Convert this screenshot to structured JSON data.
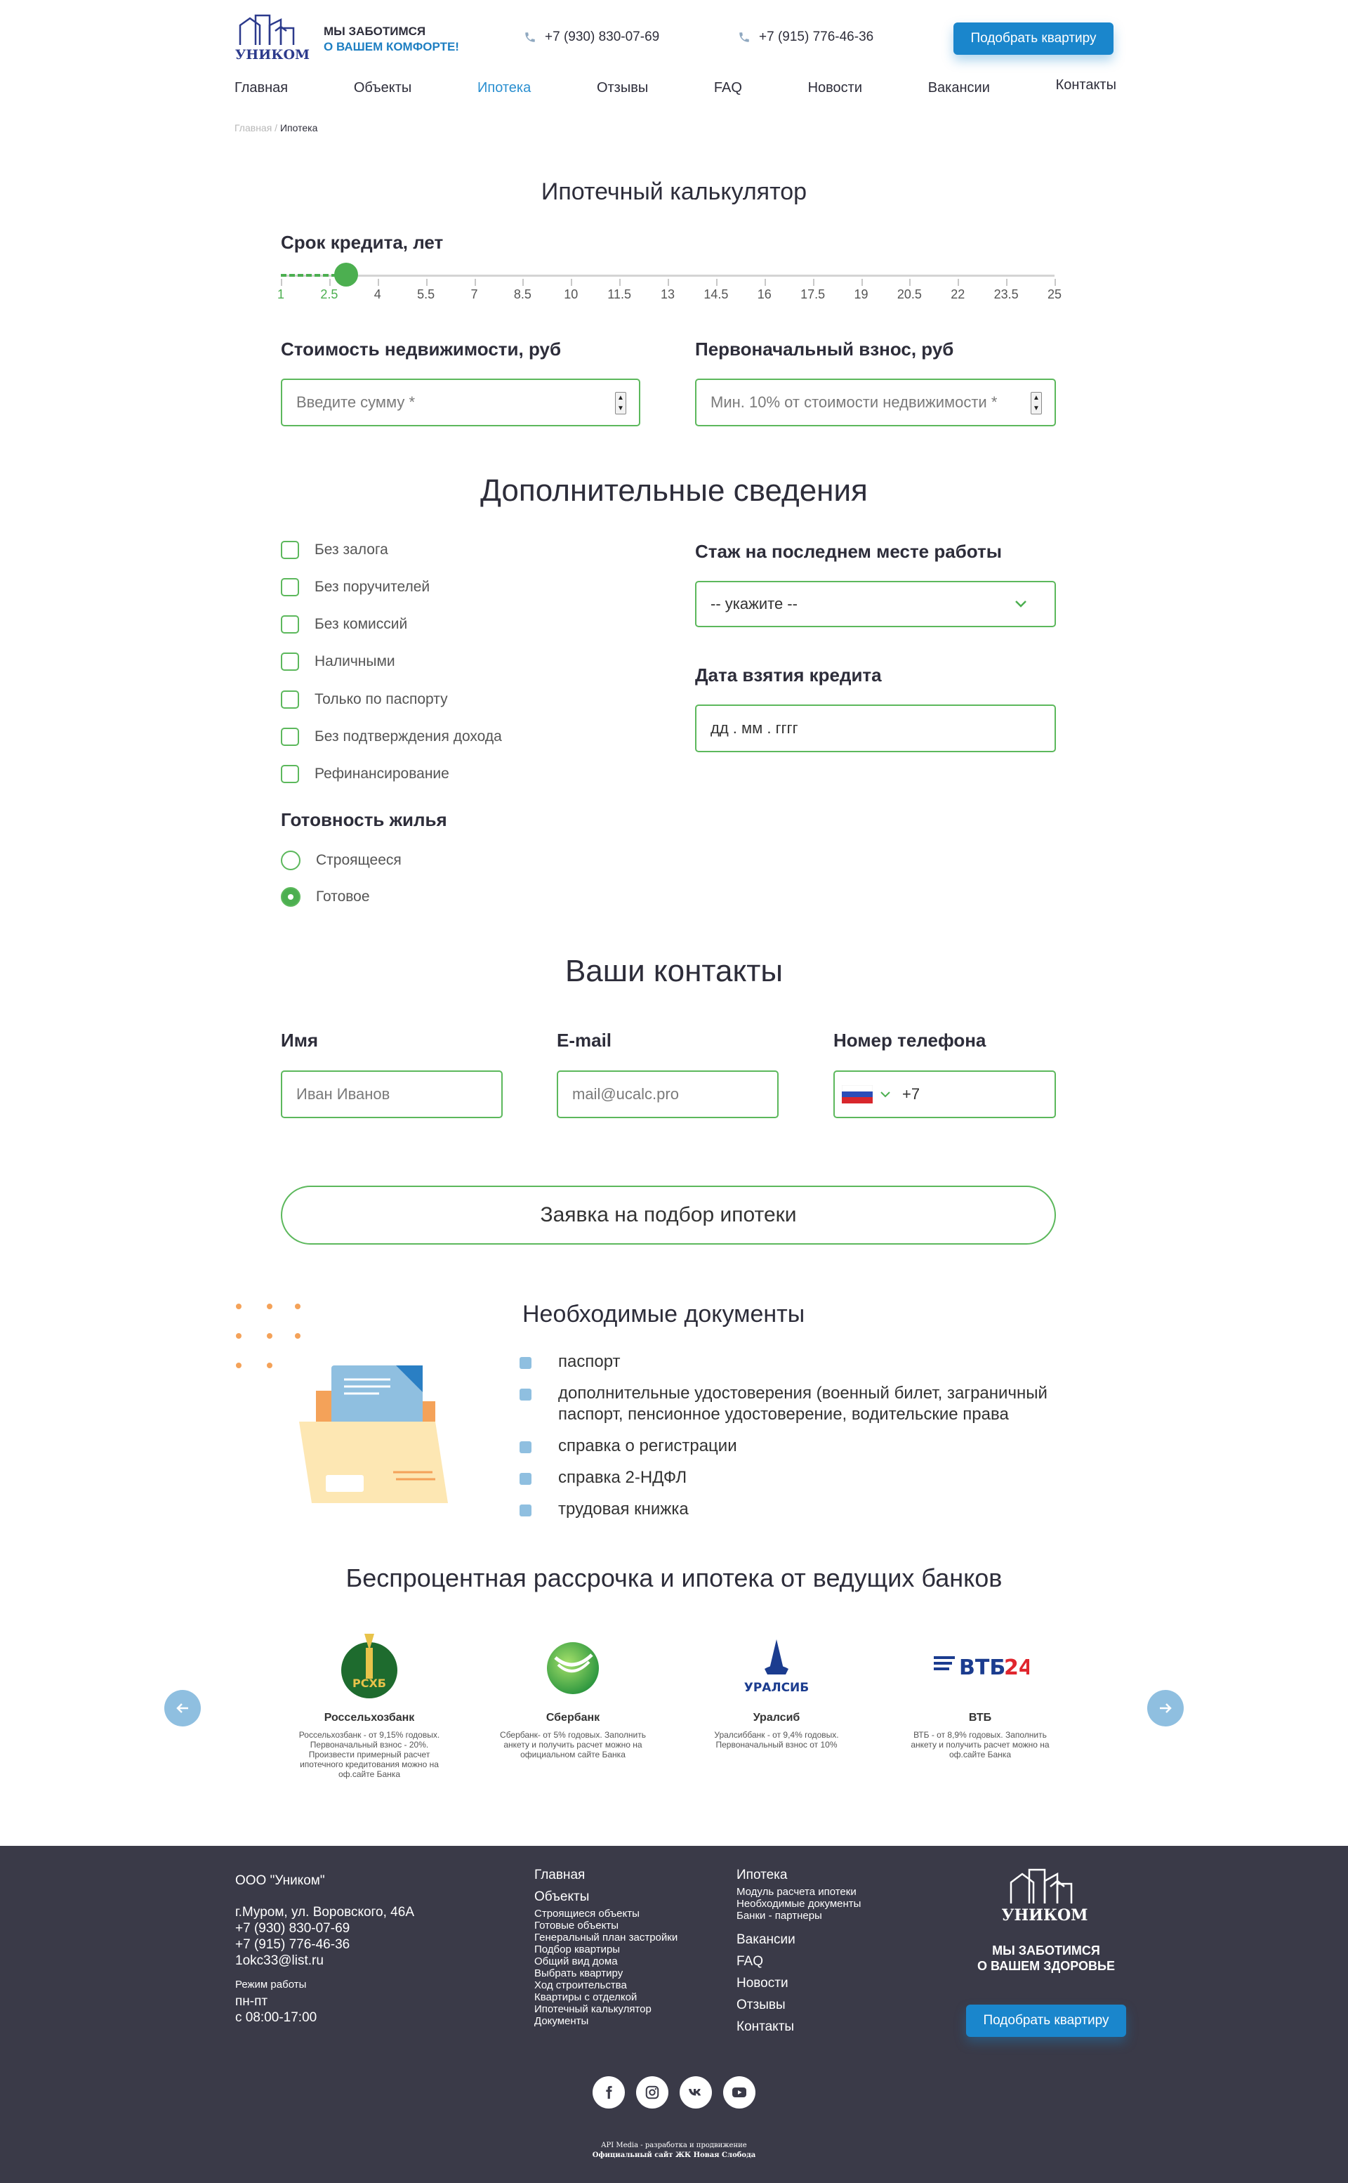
{
  "header": {
    "logo_text": "УНИКОМ",
    "tagline1": "МЫ ЗАБОТИМСЯ",
    "tagline2": "О ВАШЕМ КОМФОРТЕ!",
    "phone1": "+7 (930) 830-07-69",
    "phone2": "+7 (915) 776-46-36",
    "cta": "Подобрать квартиру"
  },
  "nav": [
    "Главная",
    "Объекты",
    "Ипотека",
    "Отзывы",
    "FAQ",
    "Новости",
    "Вакансии",
    "Контакты"
  ],
  "nav_active": "Ипотека",
  "breadcrumb": {
    "home": "Главная",
    "sep": " / ",
    "current": "Ипотека"
  },
  "calculator": {
    "title": "Ипотечный калькулятор",
    "term_label": "Срок кредита, лет",
    "term_value": 2.5,
    "term_ticks": [
      "1",
      "2.5",
      "4",
      "5.5",
      "7",
      "8.5",
      "10",
      "11.5",
      "13",
      "14.5",
      "16",
      "17.5",
      "19",
      "20.5",
      "22",
      "23.5",
      "25"
    ],
    "price_label": "Стоимость недвижимости, руб",
    "price_placeholder": "Введите сумму *",
    "down_label": "Первоначальный взнос, руб",
    "down_placeholder": "Мин. 10% от стоимости недвижимости *"
  },
  "extra": {
    "title": "Дополнительные сведения",
    "checkboxes": [
      "Без залога",
      "Без поручителей",
      "Без комиссий",
      "Наличными",
      "Только по паспорту",
      "Без подтверждения дохода",
      "Рефинансирование"
    ],
    "readiness_label": "Готовность жилья",
    "radios": [
      "Строящееся",
      "Готовое"
    ],
    "radio_selected": "Готовое",
    "experience_label": "Стаж на последнем месте работы",
    "experience_value": "-- укажите --",
    "date_label": "Дата взятия кредита",
    "date_placeholder": "дд . мм . гггг"
  },
  "contacts": {
    "title": "Ваши контакты",
    "name_label": "Имя",
    "name_placeholder": "Иван Иванов",
    "email_label": "E-mail",
    "email_placeholder": "mail@ucalc.pro",
    "phone_label": "Номер телефона",
    "phone_prefix": "+7",
    "submit": "Заявка на подбор ипотеки"
  },
  "documents": {
    "title": "Необходимые документы",
    "items": [
      "паспорт",
      "дополнительные удостоверения (военный билет, заграничный паспорт, пенсионное удостоверение, водительские права",
      "справка о регистрации",
      "справка 2-НДФЛ",
      "трудовая книжка"
    ]
  },
  "banks": {
    "title": "Беспроцентная рассрочка и ипотека от ведущих банков",
    "items": [
      {
        "name": "Россельхозбанк",
        "desc": "Россельхозбанк - от 9,15% годовых. Первоначальный взнос - 20%. Произвести примерный расчет ипотечного кредитования можно на оф.сайте Банка",
        "logo_text": "РСХБ"
      },
      {
        "name": "Сбербанк",
        "desc": "Сбербанк- от 5% годовых. Заполнить анкету и получить расчет можно на официальном сайте Банка",
        "logo_text": ""
      },
      {
        "name": "Уралсиб",
        "desc": "Уралсиббанк - от 9,4% годовых. Первоначальный взнос от 10%",
        "logo_text": "УРАЛСИБ"
      },
      {
        "name": "ВТБ",
        "desc": "ВТБ - от 8,9% годовых. Заполнить анкету и получить расчет можно на оф.сайте Банка",
        "logo_text": "ВТБ24"
      }
    ]
  },
  "footer": {
    "company": "ООО \"Уником\"",
    "address": "г.Муром, ул. Воровского, 46А",
    "phone1": "+7 (930) 830-07-69",
    "phone2": "+7 (915) 776-46-36",
    "email": "1okc33@list.ru",
    "hours_label": "Режим работы",
    "days": "пн-пт",
    "hours": "с 08:00-17:00",
    "col2_main": [
      "Главная",
      "Объекты"
    ],
    "col2_sub": [
      "Строящиеся объекты",
      "Готовые объекты",
      "Генеральный план застройки",
      "Подбор квартиры",
      "Общий вид дома",
      "Выбрать квартиру",
      "Ход строительства",
      "Квартиры с отделкой",
      "Ипотечный калькулятор",
      "Документы"
    ],
    "col3_main": "Ипотека",
    "col3_sub": [
      "Модуль расчета ипотеки",
      "Необходимые документы",
      "Банки - партнеры"
    ],
    "col3_links": [
      "Вакансии",
      "FAQ",
      "Новости",
      "Отзывы",
      "Контакты"
    ],
    "logo_text": "УНИКОМ",
    "tagline1": "МЫ ЗАБОТИМСЯ",
    "tagline2": "О ВАШЕМ ЗДОРОВЬЕ",
    "cta": "Подобрать квартиру",
    "credit1": "API Media - разработка и продвижение",
    "credit2": "Официальный сайт ЖК Новая Слобода"
  },
  "colors": {
    "accent_blue": "#1a86cc",
    "green": "#4caf50",
    "footer_bg": "#3a3a48"
  }
}
